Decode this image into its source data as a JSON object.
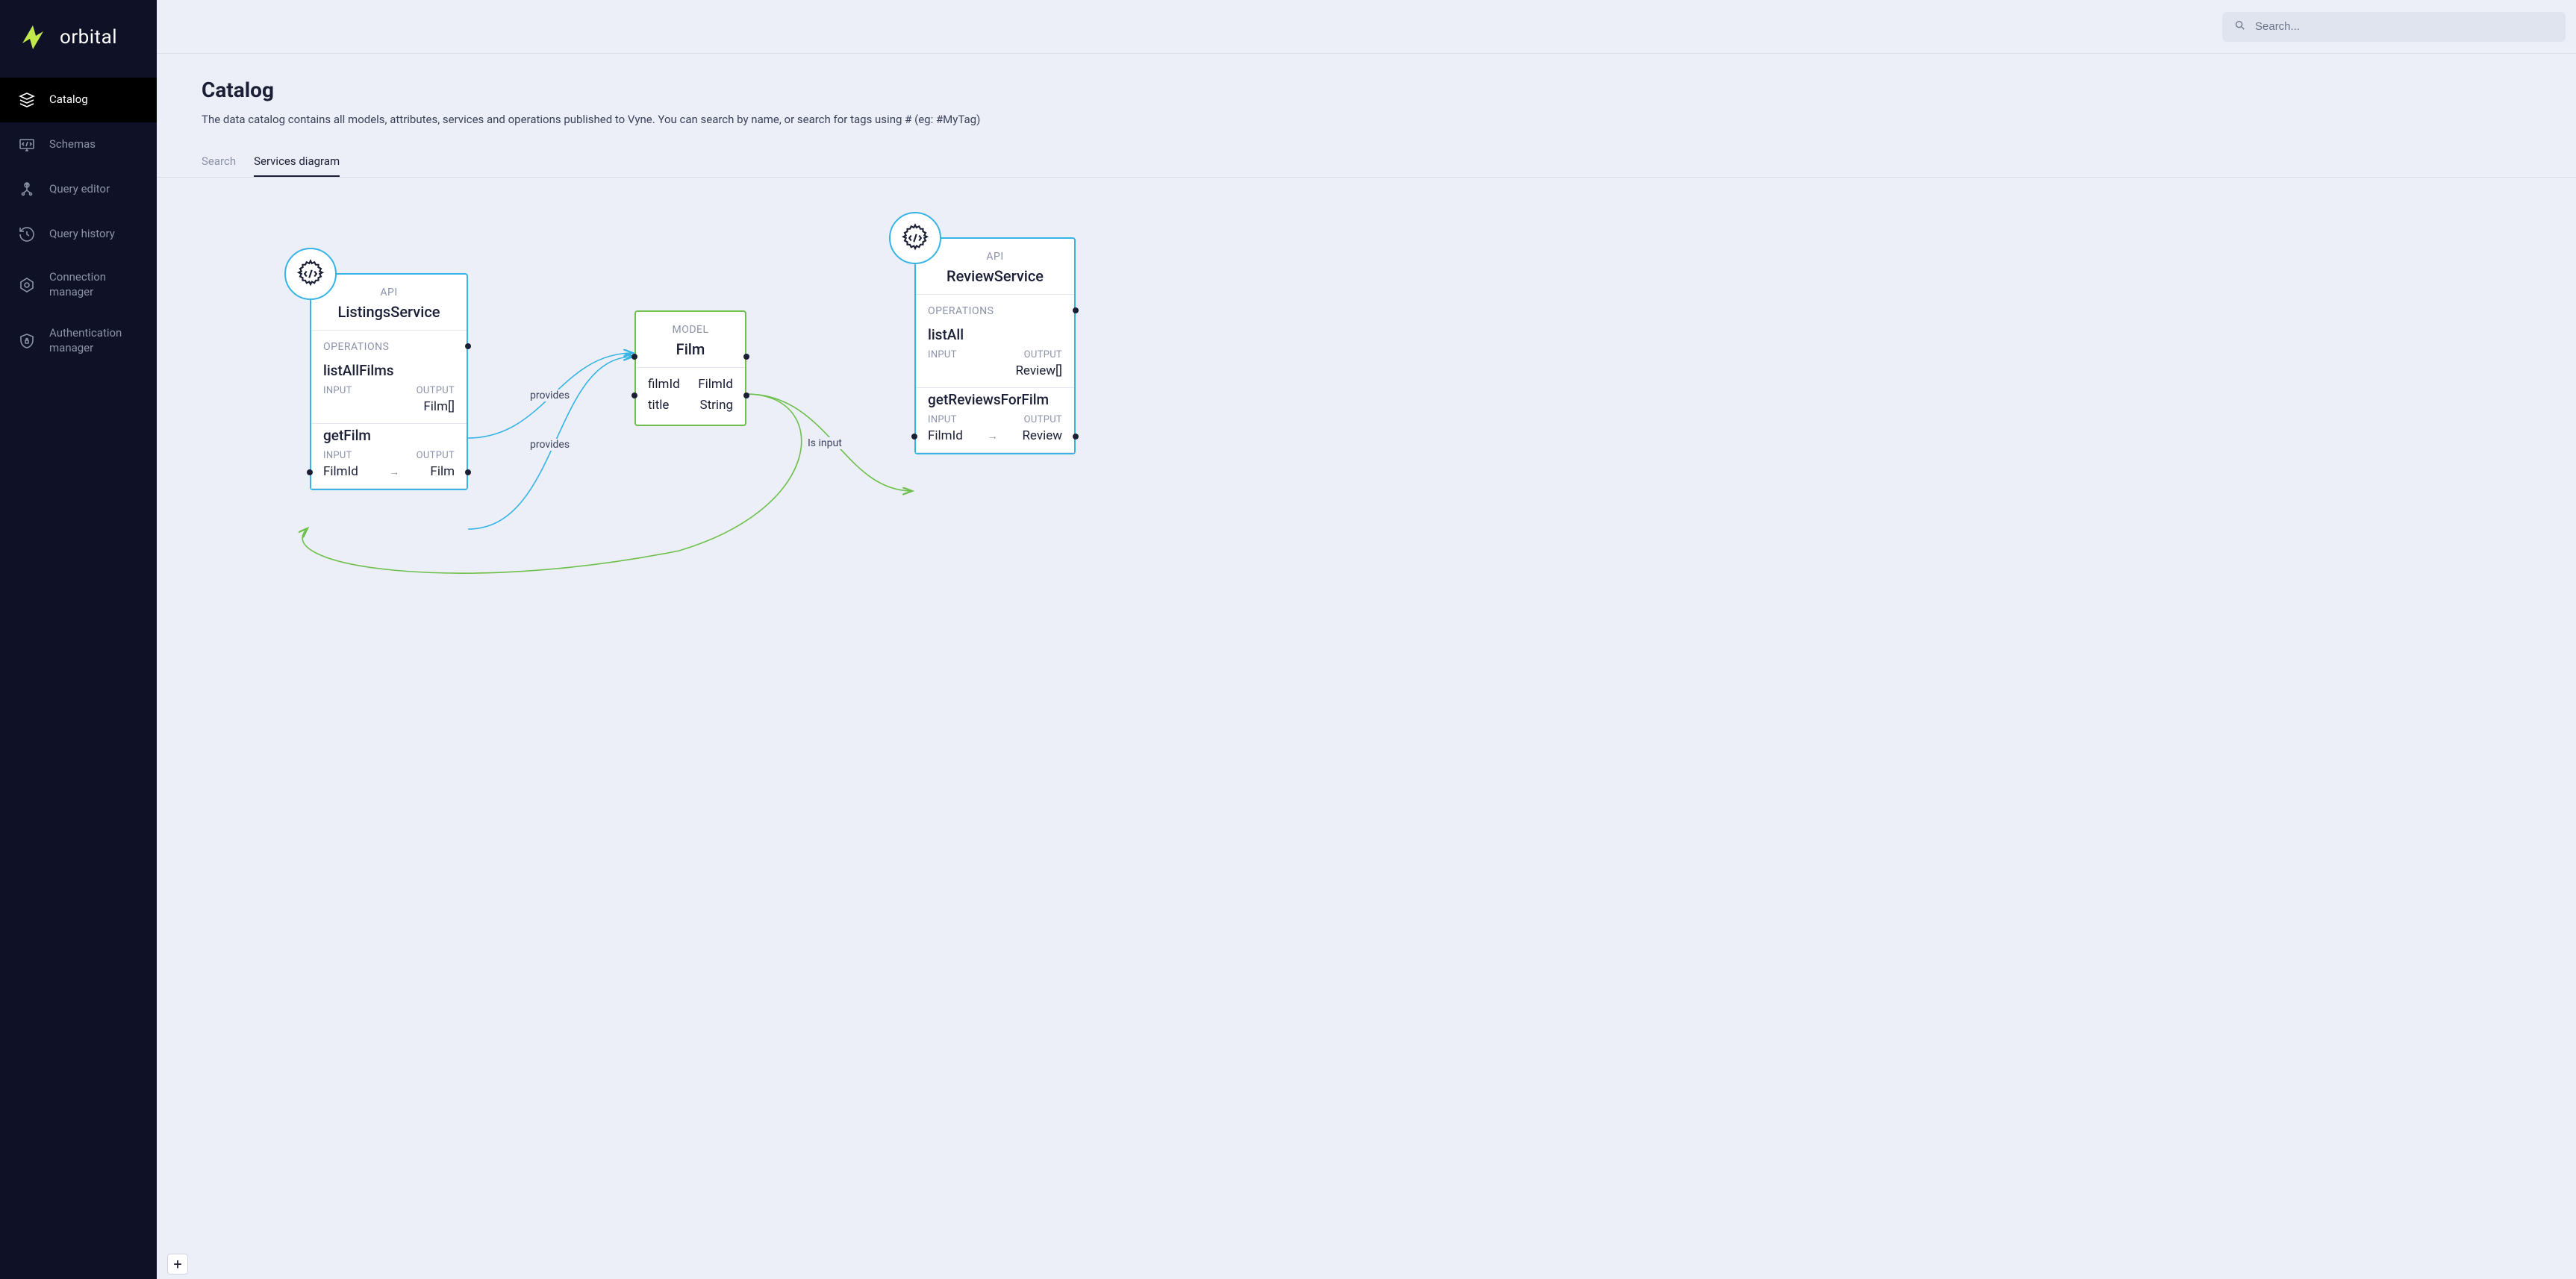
{
  "brand": {
    "name": "orbital"
  },
  "search": {
    "placeholder": "Search..."
  },
  "sidebar": {
    "items": [
      {
        "label": "Catalog",
        "icon": "catalog-icon",
        "active": true
      },
      {
        "label": "Schemas",
        "icon": "schemas-icon",
        "active": false
      },
      {
        "label": "Query editor",
        "icon": "query-editor-icon",
        "active": false
      },
      {
        "label": "Query history",
        "icon": "query-history-icon",
        "active": false
      },
      {
        "label": "Connection manager",
        "icon": "connection-manager-icon",
        "active": false
      },
      {
        "label": "Authentication manager",
        "icon": "auth-manager-icon",
        "active": false
      }
    ]
  },
  "page": {
    "title": "Catalog",
    "description": "The data catalog contains all models, attributes, services and operations published to Vyne. You can search by name, or search for tags using # (eg: #MyTag)"
  },
  "tabs": [
    {
      "label": "Search",
      "active": false
    },
    {
      "label": "Services diagram",
      "active": true
    }
  ],
  "add_button": "+",
  "diagram": {
    "labels": {
      "api": "API",
      "model": "MODEL",
      "operations": "OPERATIONS",
      "input": "INPUT",
      "output": "OUTPUT",
      "arrow": "→"
    },
    "edges": {
      "provides1": "provides",
      "provides2": "provides",
      "is_input": "Is input"
    },
    "nodes": {
      "listings": {
        "kind": "API",
        "title": "ListingsService",
        "operations": [
          {
            "name": "listAllFilms",
            "input": "",
            "output": "Film[]"
          },
          {
            "name": "getFilm",
            "input": "FilmId",
            "output": "Film"
          }
        ]
      },
      "film": {
        "kind": "MODEL",
        "title": "Film",
        "fields": [
          {
            "name": "filmId",
            "type": "FilmId"
          },
          {
            "name": "title",
            "type": "String"
          }
        ]
      },
      "review": {
        "kind": "API",
        "title": "ReviewService",
        "operations": [
          {
            "name": "listAll",
            "input": "",
            "output": "Review[]"
          },
          {
            "name": "getReviewsForFilm",
            "input": "FilmId",
            "output": "Review"
          }
        ]
      }
    }
  }
}
